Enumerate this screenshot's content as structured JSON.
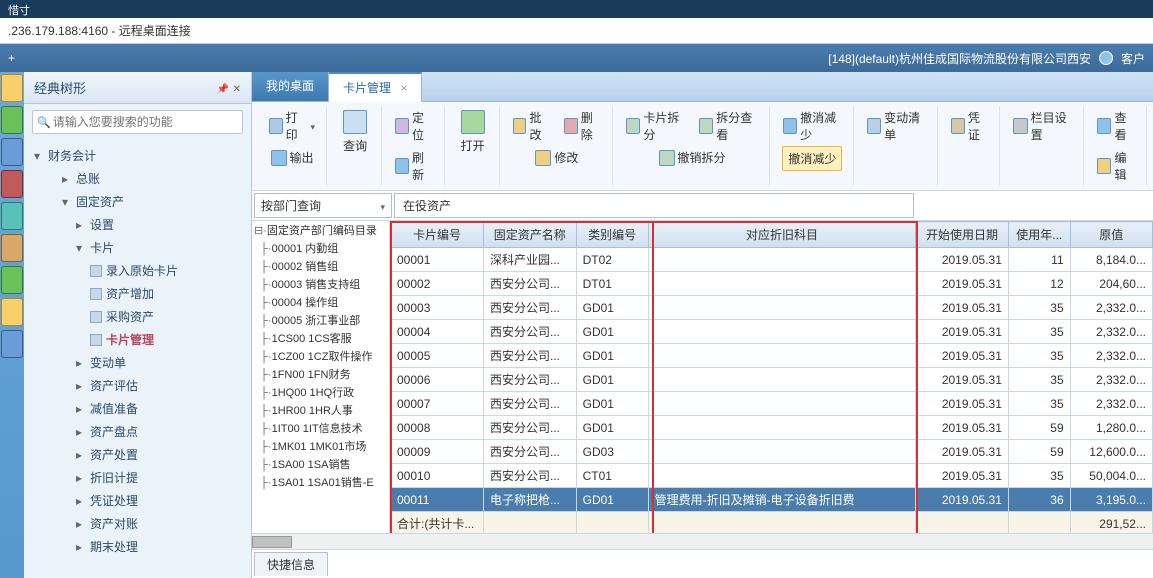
{
  "titlebar_top": "惜寸",
  "titlebar": ".236.179.188:4160 - 远程桌面连接",
  "header": {
    "company": "[148](default)杭州佳成国际物流股份有限公司西安",
    "customer": "客户"
  },
  "sidebar": {
    "title": "经典树形",
    "search_placeholder": "请输入您要搜索的功能",
    "root": "财务会计",
    "items": [
      {
        "label": "总账",
        "indent": 2,
        "arrow": "right"
      },
      {
        "label": "固定资产",
        "indent": 2,
        "arrow": "down"
      },
      {
        "label": "设置",
        "indent": 3,
        "arrow": "right"
      },
      {
        "label": "卡片",
        "indent": 3,
        "arrow": "down"
      },
      {
        "label": "录入原始卡片",
        "indent": 4,
        "leaf": true
      },
      {
        "label": "资产增加",
        "indent": 4,
        "leaf": true
      },
      {
        "label": "采购资产",
        "indent": 4,
        "leaf": true
      },
      {
        "label": "卡片管理",
        "indent": 4,
        "leaf": true,
        "selected": true
      },
      {
        "label": "变动单",
        "indent": 3,
        "arrow": "right"
      },
      {
        "label": "资产评估",
        "indent": 3,
        "arrow": "right"
      },
      {
        "label": "减值准备",
        "indent": 3,
        "arrow": "right"
      },
      {
        "label": "资产盘点",
        "indent": 3,
        "arrow": "right"
      },
      {
        "label": "资产处置",
        "indent": 3,
        "arrow": "right"
      },
      {
        "label": "折旧计提",
        "indent": 3,
        "arrow": "right"
      },
      {
        "label": "凭证处理",
        "indent": 3,
        "arrow": "right"
      },
      {
        "label": "资产对账",
        "indent": 3,
        "arrow": "right"
      },
      {
        "label": "期末处理",
        "indent": 3,
        "arrow": "right"
      }
    ]
  },
  "tabs": [
    {
      "label": "我的桌面",
      "active": false
    },
    {
      "label": "卡片管理",
      "active": true
    }
  ],
  "toolbar": {
    "print": "打印",
    "export": "输出",
    "query": "查询",
    "refresh": "刷新",
    "locate": "定位",
    "open": "打开",
    "batch": "批改",
    "modify": "修改",
    "delete": "删除",
    "split": "卡片拆分",
    "split_view": "拆分查看",
    "cancel_split": "撤销拆分",
    "cancel_dec": "撤消减少",
    "cancel_dec_hl": "撤消减少",
    "change_list": "变动清单",
    "cert": "凭证",
    "col_cfg": "栏目设置",
    "view": "查看",
    "edit": "编辑"
  },
  "filter": {
    "mode": "按部门查询",
    "status": "在役资产"
  },
  "dept_tree": {
    "root": "固定资产部门编码目录",
    "items": [
      "00001 内勤组",
      "00002 销售组",
      "00003 销售支持组",
      "00004 操作组",
      "00005 浙江事业部",
      "1CS00 1CS客服",
      "1CZ00 1CZ取件操作",
      "1FN00 1FN财务",
      "1HQ00 1HQ行政",
      "1HR00 1HR人事",
      "1IT00 1IT信息技术",
      "1MK01 1MK01市场",
      "1SA00 1SA销售",
      "1SA01 1SA01销售-E"
    ]
  },
  "table": {
    "headers": [
      "卡片编号",
      "固定资产名称",
      "类别编号",
      "对应折旧科目",
      "开始使用日期",
      "使用年...",
      "原值"
    ],
    "rows": [
      {
        "c": [
          "00001",
          "深科产业园...",
          "DT02",
          "",
          "2019.05.31",
          "11",
          "8,184.0..."
        ]
      },
      {
        "c": [
          "00002",
          "西安分公司...",
          "DT01",
          "",
          "2019.05.31",
          "12",
          "204,60..."
        ]
      },
      {
        "c": [
          "00003",
          "西安分公司...",
          "GD01",
          "",
          "2019.05.31",
          "35",
          "2,332.0..."
        ]
      },
      {
        "c": [
          "00004",
          "西安分公司...",
          "GD01",
          "",
          "2019.05.31",
          "35",
          "2,332.0..."
        ]
      },
      {
        "c": [
          "00005",
          "西安分公司...",
          "GD01",
          "",
          "2019.05.31",
          "35",
          "2,332.0..."
        ]
      },
      {
        "c": [
          "00006",
          "西安分公司...",
          "GD01",
          "",
          "2019.05.31",
          "35",
          "2,332.0..."
        ]
      },
      {
        "c": [
          "00007",
          "西安分公司...",
          "GD01",
          "",
          "2019.05.31",
          "35",
          "2,332.0..."
        ]
      },
      {
        "c": [
          "00008",
          "西安分公司...",
          "GD01",
          "",
          "2019.05.31",
          "59",
          "1,280.0..."
        ]
      },
      {
        "c": [
          "00009",
          "西安分公司...",
          "GD03",
          "",
          "2019.05.31",
          "59",
          "12,600.0..."
        ]
      },
      {
        "c": [
          "00010",
          "西安分公司...",
          "CT01",
          "",
          "2019.05.31",
          "35",
          "50,004.0..."
        ]
      },
      {
        "c": [
          "00011",
          "电子称把枪...",
          "GD01",
          "管理费用-折旧及摊销-电子设备折旧费",
          "2019.05.31",
          "36",
          "3,195.0..."
        ],
        "selected": true
      }
    ],
    "total_label": "合计:(共计卡...",
    "total_value": "291,52..."
  },
  "bottom_tab": "快捷信息"
}
